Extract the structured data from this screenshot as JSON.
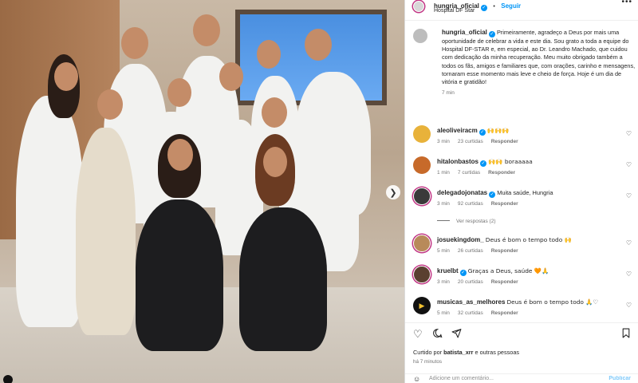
{
  "post": {
    "username": "hungria_oficial",
    "follow_label": "Seguir",
    "location": "Hospital DF Star",
    "more": "•••"
  },
  "caption": {
    "username": "hungria_oficial",
    "text": "Primeiramente, agradeço a Deus por mais uma oportunidade de celebrar a vida e este dia. Sou grato a toda a equipe do Hospital DF-STAR e, em especial, ao Dr. Leandro Machado, que cuidou com dedicação da minha recuperação. Meu muito obrigado também a todos os fãs, amigos e familiares que, com orações, carinho e mensagens, tornaram esse momento mais leve e cheio de força. Hoje é um dia de vitória e gratidão!",
    "time": "7 min"
  },
  "comments": [
    {
      "username": "aleoliveiracm",
      "verified": true,
      "text": "🙌🙌🙌",
      "time": "3 min",
      "likes": "23 curtidas",
      "reply": "Responder"
    },
    {
      "username": "hitalonbastos",
      "verified": true,
      "text": "🙌🙌 boraaaaa",
      "time": "1 min",
      "likes": "7 curtidas",
      "reply": "Responder"
    },
    {
      "username": "delegadojonatas",
      "verified": true,
      "text": "Muita saúde, Hungria",
      "time": "3 min",
      "likes": "92 curtidas",
      "reply": "Responder"
    },
    {
      "username": "josuekingdom_",
      "verified": false,
      "text": "Deus é bom o tempo todo 🙌",
      "time": "5 min",
      "likes": "26 curtidas",
      "reply": "Responder"
    },
    {
      "username": "kruelbt",
      "verified": true,
      "text": "Graças a Deus, saúde 🧡🙏",
      "time": "3 min",
      "likes": "20 curtidas",
      "reply": "Responder"
    },
    {
      "username": "musicas_as_melhores",
      "verified": false,
      "text": "Deus é bom o tempo todo 🙏♡",
      "time": "5 min",
      "likes": "32 curtidas",
      "reply": "Responder"
    }
  ],
  "view_replies": "Ver respostas (2)",
  "footer": {
    "liked_prefix": "Curtido por ",
    "liked_user": "batista_xrr",
    "liked_suffix": " e outras pessoas",
    "ago": "há 7 minutos",
    "add_comment": "Adicione um comentário...",
    "publish": "Publicar"
  },
  "icons": {
    "heart": "heart-icon",
    "comment": "comment-icon",
    "share": "share-icon",
    "save": "bookmark-icon"
  },
  "colors": {
    "link": "#0095f6",
    "text": "#262626",
    "muted": "#737373"
  }
}
